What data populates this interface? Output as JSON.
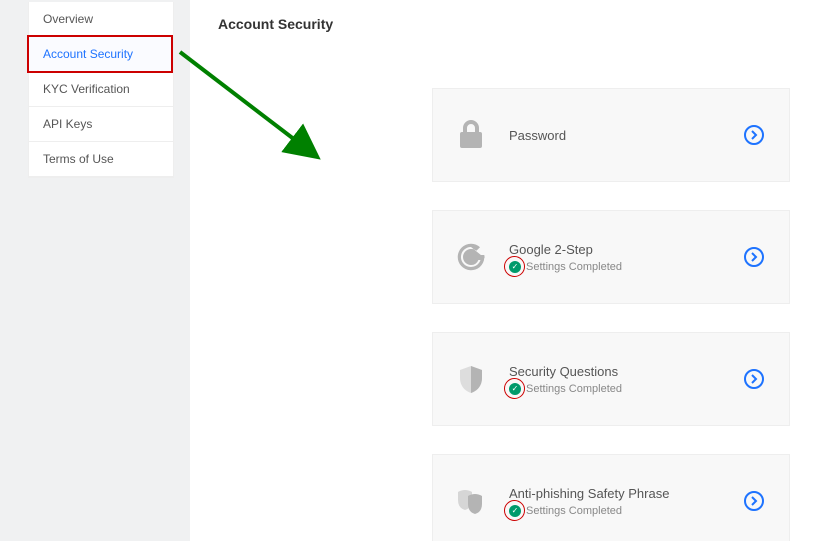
{
  "sidebar": {
    "items": [
      {
        "label": "Overview"
      },
      {
        "label": "Account Security"
      },
      {
        "label": "KYC Verification"
      },
      {
        "label": "API Keys"
      },
      {
        "label": "Terms of Use"
      }
    ],
    "selectedIndex": 1
  },
  "header": {
    "title": "Account Security"
  },
  "cards": [
    {
      "title": "Password",
      "status": null,
      "icon": "lock"
    },
    {
      "title": "Google 2-Step",
      "status": "Settings Completed",
      "icon": "google"
    },
    {
      "title": "Security Questions",
      "status": "Settings Completed",
      "icon": "shield"
    },
    {
      "title": "Anti-phishing Safety Phrase",
      "status": "Settings Completed",
      "icon": "masks"
    }
  ],
  "colors": {
    "accent": "#1e73ff",
    "success": "#009a6b",
    "annotation": "#cc0000",
    "arrow": "#008000"
  }
}
